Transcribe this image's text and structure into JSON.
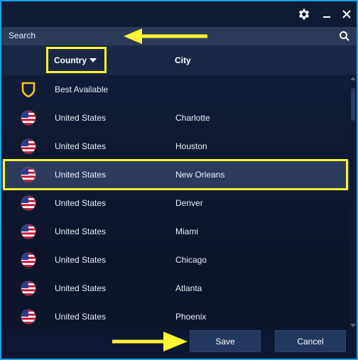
{
  "toolbar": {
    "settings_icon": "gear-icon",
    "minimize_icon": "minimize-icon",
    "close_icon": "close-icon"
  },
  "search": {
    "label": "Search",
    "icon": "search-icon"
  },
  "table": {
    "columns": {
      "country": "Country",
      "city": "City"
    },
    "sort": {
      "column": "Country",
      "direction": "descending-caret"
    },
    "rows": [
      {
        "icon": "shield-icon",
        "country": "Best Available",
        "city": ""
      },
      {
        "icon": "us-flag-icon",
        "country": "United States",
        "city": "Charlotte"
      },
      {
        "icon": "us-flag-icon",
        "country": "United States",
        "city": "Houston"
      },
      {
        "icon": "us-flag-icon",
        "country": "United States",
        "city": "New Orleans",
        "selected": true
      },
      {
        "icon": "us-flag-icon",
        "country": "United States",
        "city": "Denver"
      },
      {
        "icon": "us-flag-icon",
        "country": "United States",
        "city": "Miami"
      },
      {
        "icon": "us-flag-icon",
        "country": "United States",
        "city": "Chicago"
      },
      {
        "icon": "us-flag-icon",
        "country": "United States",
        "city": "Atlanta"
      },
      {
        "icon": "us-flag-icon",
        "country": "United States",
        "city": "Phoenix"
      }
    ]
  },
  "footer": {
    "save_label": "Save",
    "cancel_label": "Cancel"
  },
  "colors": {
    "highlight": "#fff534",
    "window_border": "#1aa1e6",
    "selected_row": "#2c3b5c",
    "button": "#22385f"
  }
}
